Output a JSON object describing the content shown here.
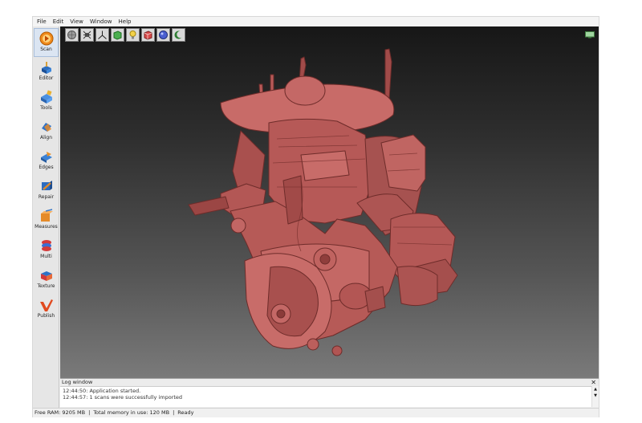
{
  "menu": [
    "File",
    "Edit",
    "View",
    "Window",
    "Help"
  ],
  "sidebar": [
    {
      "label": "Scan",
      "icon": "scan-icon"
    },
    {
      "label": "Editor",
      "icon": "editor-icon"
    },
    {
      "label": "Tools",
      "icon": "tools-icon"
    },
    {
      "label": "Align",
      "icon": "align-icon"
    },
    {
      "label": "Edges",
      "icon": "edges-icon"
    },
    {
      "label": "Repair",
      "icon": "repair-icon"
    },
    {
      "label": "Measures",
      "icon": "measures-icon"
    },
    {
      "label": "Multi",
      "icon": "multi-icon"
    },
    {
      "label": "Texture",
      "icon": "texture-icon"
    },
    {
      "label": "Publish",
      "icon": "publish-icon"
    }
  ],
  "toolbar_icons": [
    "sphere-view-icon",
    "vertices-view-icon",
    "axes-icon",
    "flat-shading-icon",
    "light-icon",
    "solid-box-icon",
    "smooth-sphere-icon",
    "crescent-icon"
  ],
  "model_color": "#b85a58",
  "log": {
    "title": "Log window",
    "lines": [
      "12:44:50: Application started.",
      "12:44:57: 1 scans were successfully imported"
    ]
  },
  "status": {
    "free_ram": "Free RAM: 9205 MB",
    "memory": "Total memory in use: 120 MB",
    "state": "Ready"
  }
}
